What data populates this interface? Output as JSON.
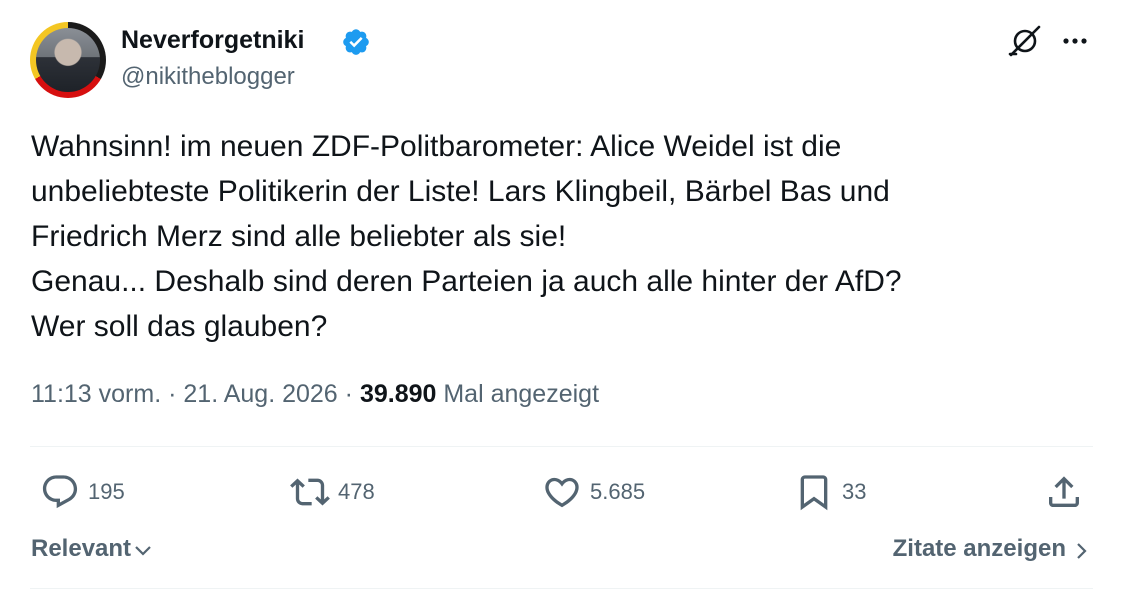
{
  "author": {
    "display_name": "Neverforgetniki",
    "handle": "@nikitheblogger",
    "verified": true
  },
  "tweet": {
    "lines": [
      "Wahnsinn! im neuen ZDF-Politbarometer: Alice Weidel ist die",
      "unbeliebteste Politikerin der Liste! Lars Klingbeil, Bärbel Bas und",
      "Friedrich Merz sind alle beliebter als sie!",
      "Genau... Deshalb sind deren Parteien ja auch alle hinter der AfD?",
      "Wer soll das glauben?"
    ],
    "time": "11:13 vorm.",
    "separator": "·",
    "date": "21. Aug. 2026",
    "views_count": "39.890",
    "views_label": "Mal angezeigt"
  },
  "actions": {
    "replies": "195",
    "retweets": "478",
    "likes": "5.685",
    "bookmarks": "33"
  },
  "footer": {
    "sort_label": "Relevant",
    "quotes_label": "Zitate anzeigen"
  },
  "icons": {
    "verified": "verified-badge-icon",
    "grok": "grok-icon",
    "more": "more-icon",
    "reply": "reply-icon",
    "retweet": "retweet-icon",
    "like": "heart-icon",
    "bookmark": "bookmark-icon",
    "share": "share-icon"
  },
  "colors": {
    "text": "#0f1419",
    "secondary": "#536471",
    "verified": "#1d9bf0",
    "divider": "#eff3f4"
  }
}
